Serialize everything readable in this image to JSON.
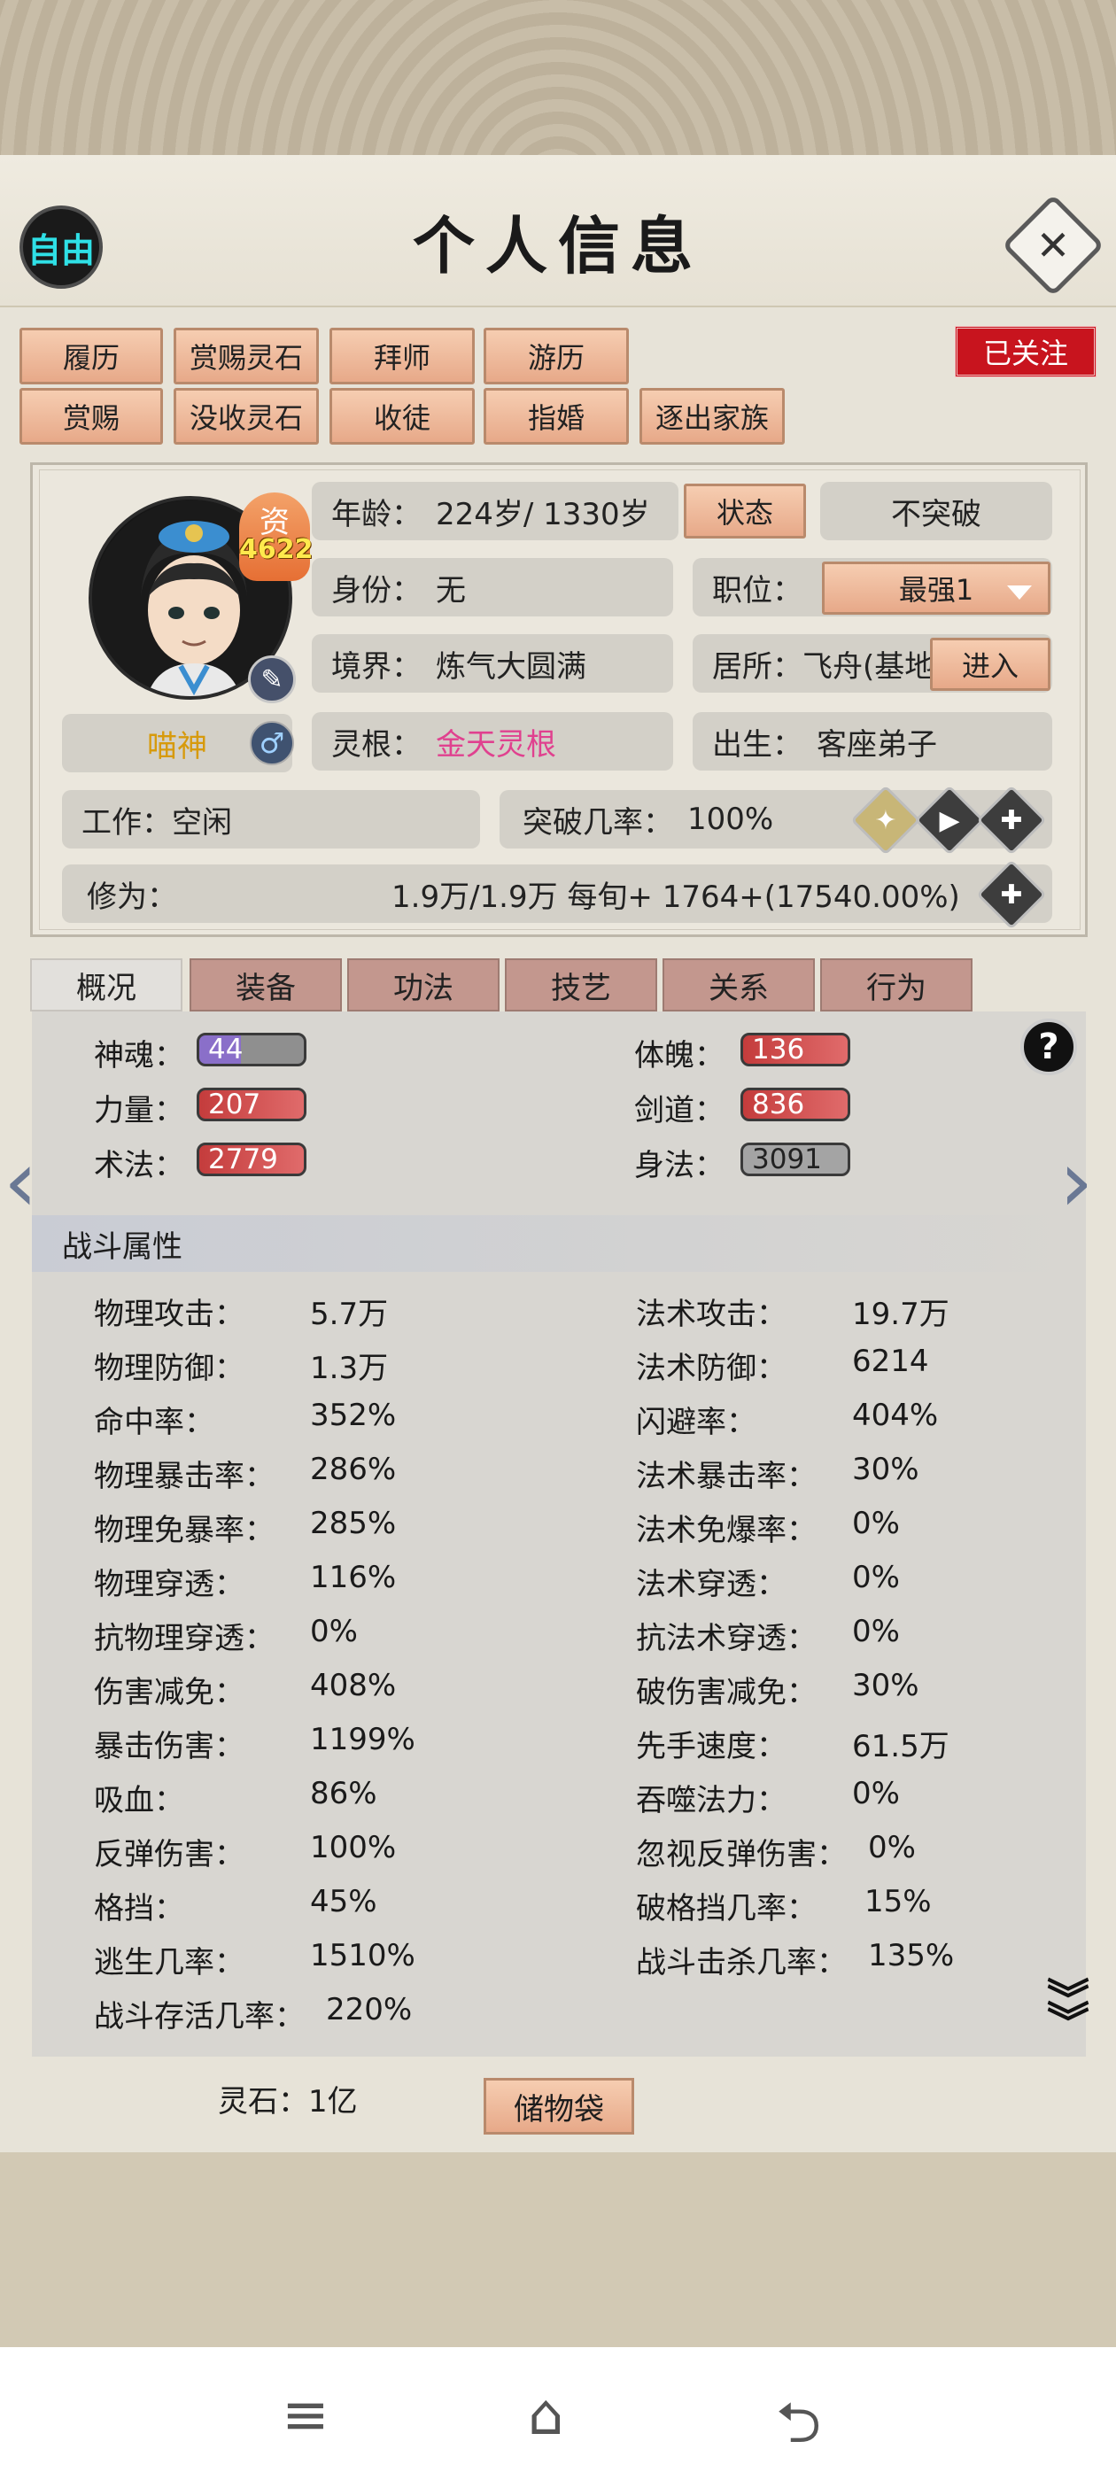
{
  "header": {
    "title": "个人信息",
    "free_label": "自由",
    "close_glyph": "✕"
  },
  "actions_row1": [
    "履历",
    "赏赐灵石",
    "拜师",
    "游历"
  ],
  "actions_row2": [
    "赏赐",
    "没收灵石",
    "收徒",
    "指婚",
    "逐出家族"
  ],
  "follow_label": "已关注",
  "profile": {
    "aptitude_label": "资",
    "aptitude_value": "4622",
    "name": "喵神",
    "gender_glyph": "♂",
    "age_label": "年龄：",
    "age_value": "224岁/ 1330岁",
    "status_button": "状态",
    "breakthrough_button": "不突破",
    "identity_label": "身份：",
    "identity_value": "无",
    "position_label": "职位：",
    "position_value": "最强1",
    "realm_label": "境界：",
    "realm_value": "炼气大圆满",
    "residence_label": "居所：",
    "residence_value": "飞舟(基地",
    "enter_button": "进入",
    "root_label": "灵根：",
    "root_value": "金天灵根",
    "origin_label": "出生：",
    "origin_value": "客座弟子",
    "work_label": "工作：",
    "work_value": "空闲",
    "bt_rate_label": "突破几率：",
    "bt_rate_value": "100%",
    "cultivation_label": "修为：",
    "cultivation_value": "1.9万/1.9万  每旬+  1764+(17540.00%)"
  },
  "tabs": [
    "概况",
    "装备",
    "功法",
    "技艺",
    "关系",
    "行为"
  ],
  "attributes": [
    {
      "label": "神魂：",
      "value": "44",
      "color": "#8a6fc9"
    },
    {
      "label": "体魄：",
      "value": "136",
      "color": "#d9534f"
    },
    {
      "label": "力量：",
      "value": "207",
      "color": "#cf4b4b"
    },
    {
      "label": "剑道：",
      "value": "836",
      "color": "#d9534f"
    },
    {
      "label": "术法：",
      "value": "2779",
      "color": "#cf4b4b"
    },
    {
      "label": "身法：",
      "value": "3091",
      "color": "#9a9a9a"
    }
  ],
  "combat": {
    "heading": "战斗属性",
    "left": [
      {
        "label": "物理攻击：",
        "value": "5.7万"
      },
      {
        "label": "物理防御：",
        "value": "1.3万"
      },
      {
        "label": "命中率：",
        "value": "352%"
      },
      {
        "label": "物理暴击率：",
        "value": "286%"
      },
      {
        "label": "物理免暴率：",
        "value": "285%"
      },
      {
        "label": "物理穿透：",
        "value": "116%"
      },
      {
        "label": "抗物理穿透：",
        "value": "0%"
      },
      {
        "label": "伤害减免：",
        "value": "408%"
      },
      {
        "label": "暴击伤害：",
        "value": "1199%"
      },
      {
        "label": "吸血：",
        "value": "86%"
      },
      {
        "label": "反弹伤害：",
        "value": "100%"
      },
      {
        "label": "格挡：",
        "value": "45%"
      },
      {
        "label": "逃生几率：",
        "value": "1510%"
      },
      {
        "label": "战斗存活几率：",
        "value": "220%"
      }
    ],
    "right": [
      {
        "label": "法术攻击：",
        "value": "19.7万"
      },
      {
        "label": "法术防御：",
        "value": "6214"
      },
      {
        "label": "闪避率：",
        "value": "404%"
      },
      {
        "label": "法术暴击率：",
        "value": "30%"
      },
      {
        "label": "法术免爆率：",
        "value": "0%"
      },
      {
        "label": "法术穿透：",
        "value": "0%"
      },
      {
        "label": "抗法术穿透：",
        "value": "0%"
      },
      {
        "label": "破伤害减免：",
        "value": "30%"
      },
      {
        "label": "先手速度：",
        "value": "61.5万"
      },
      {
        "label": "吞噬法力：",
        "value": "0%"
      },
      {
        "label": "忽视反弹伤害：",
        "value": "0%"
      },
      {
        "label": "破格挡几率：",
        "value": "15%"
      },
      {
        "label": "战斗击杀几率：",
        "value": "135%"
      }
    ]
  },
  "footer": {
    "spirit_stones": "灵石：1亿",
    "storage_button": "储物袋"
  },
  "icons": {
    "help": "?",
    "prev": "‹",
    "next": "›",
    "expand": "⌄",
    "nav_menu": "≡",
    "nav_home": "⌂",
    "nav_back": "⮌"
  }
}
